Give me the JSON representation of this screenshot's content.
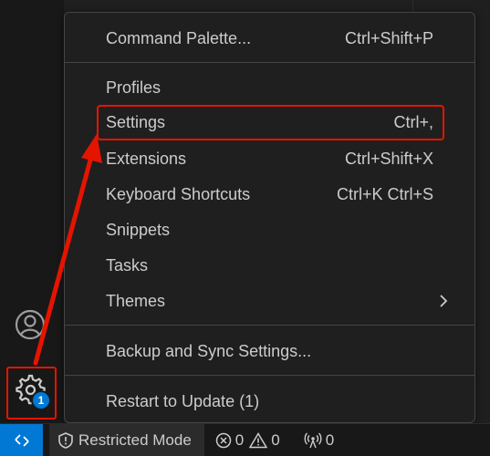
{
  "menu": {
    "items": [
      {
        "label": "Command Palette...",
        "shortcut": "Ctrl+Shift+P"
      },
      {
        "label": "Profiles",
        "shortcut": ""
      },
      {
        "label": "Settings",
        "shortcut": "Ctrl+,"
      },
      {
        "label": "Extensions",
        "shortcut": "Ctrl+Shift+X"
      },
      {
        "label": "Keyboard Shortcuts",
        "shortcut": "Ctrl+K Ctrl+S"
      },
      {
        "label": "Snippets",
        "shortcut": ""
      },
      {
        "label": "Tasks",
        "shortcut": ""
      },
      {
        "label": "Themes",
        "shortcut": ""
      },
      {
        "label": "Backup and Sync Settings...",
        "shortcut": ""
      },
      {
        "label": "Restart to Update (1)",
        "shortcut": ""
      }
    ]
  },
  "activity_bar": {
    "manage_badge": "1",
    "icons": {
      "account": "account-icon",
      "manage": "gear-icon"
    }
  },
  "status_bar": {
    "restricted_mode": "Restricted Mode",
    "errors": "0",
    "warnings": "0",
    "ports": "0"
  },
  "colors": {
    "accent": "#0078d4",
    "annotation": "#e51400",
    "menu_bg": "#1f1f1f",
    "text": "#cccccc"
  }
}
